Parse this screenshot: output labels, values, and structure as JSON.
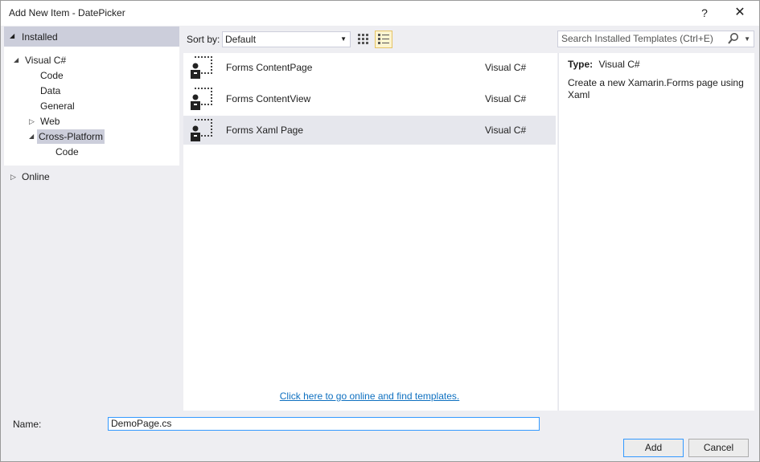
{
  "window": {
    "title": "Add New Item - DatePicker",
    "help_label": "?",
    "close_label": "✕"
  },
  "tree": {
    "installed_label": "Installed",
    "items": [
      {
        "label": "Visual C#"
      },
      {
        "label": "Code"
      },
      {
        "label": "Data"
      },
      {
        "label": "General"
      },
      {
        "label": "Web"
      },
      {
        "label": "Cross-Platform"
      },
      {
        "label": "Code"
      }
    ],
    "online_label": "Online"
  },
  "toolbar": {
    "sort_label": "Sort by:",
    "sort_value": "Default",
    "search_placeholder": "Search Installed Templates (Ctrl+E)"
  },
  "templates": [
    {
      "name": "Forms ContentPage",
      "language": "Visual C#"
    },
    {
      "name": "Forms ContentView",
      "language": "Visual C#"
    },
    {
      "name": "Forms Xaml Page",
      "language": "Visual C#"
    }
  ],
  "online_link": "Click here to go online and find templates.",
  "details": {
    "type_label": "Type:",
    "type_value": "Visual C#",
    "description": "Create a new Xamarin.Forms page using Xaml"
  },
  "name_field": {
    "label": "Name:",
    "value": "DemoPage.cs"
  },
  "buttons": {
    "add": "Add",
    "cancel": "Cancel"
  },
  "colors": {
    "accent": "#3399ff",
    "selection": "#cccedb",
    "link": "#0e70c0"
  }
}
